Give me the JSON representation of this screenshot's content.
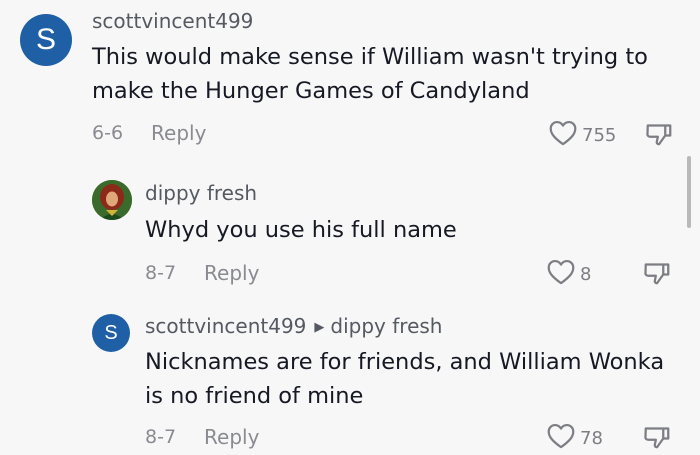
{
  "comments": [
    {
      "avatar_letter": "S",
      "username": "scottvincent499",
      "text_line1": "This would make sense if William wasn't trying to",
      "text_line2": "make the Hunger Games of Candyland",
      "date": "6-6",
      "reply_label": "Reply",
      "like_count": "755"
    },
    {
      "username": "dippy fresh",
      "text": "Whyd you use his full name",
      "date": "8-7",
      "reply_label": "Reply",
      "like_count": "8"
    },
    {
      "avatar_letter": "S",
      "username": "scottvincent499",
      "reply_to": "dippy fresh",
      "text_line1": "Nicknames are for friends, and William Wonka",
      "text_line2": "is no friend of mine",
      "date": "8-7",
      "reply_label": "Reply",
      "like_count": "78"
    }
  ],
  "colors": {
    "avatar_blue": "#1f5fa6",
    "background": "#f7f7f7",
    "meta_gray": "#8a8b91"
  }
}
